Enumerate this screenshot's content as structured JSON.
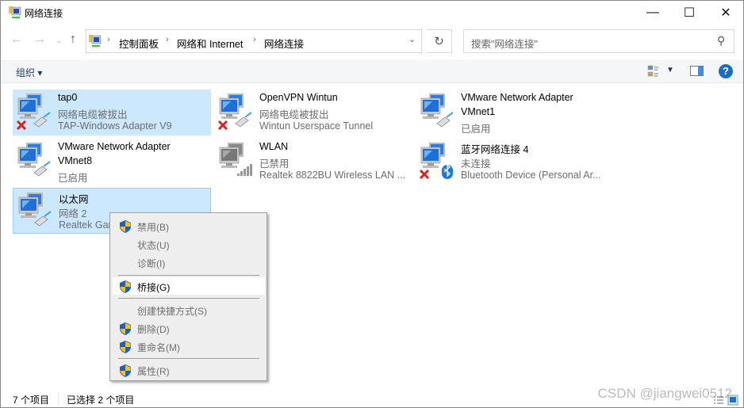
{
  "window": {
    "title": "网络连接",
    "minimize": "—",
    "maximize": "☐",
    "close": "✕"
  },
  "address": {
    "crumbs": [
      "控制面板",
      "网络和 Internet",
      "网络连接"
    ],
    "refresh": "↻"
  },
  "search": {
    "placeholder": "搜索\"网络连接\""
  },
  "toolbar": {
    "organize": "组织 ▾",
    "help": "?"
  },
  "items": [
    {
      "name": "tap0",
      "status": "网络电缆被拔出",
      "device": "TAP-Windows Adapter V9",
      "state": "disconnected",
      "selected": true
    },
    {
      "name": "OpenVPN Wintun",
      "status": "网络电缆被拔出",
      "device": "Wintun Userspace Tunnel",
      "state": "disconnected",
      "selected": false
    },
    {
      "name": "VMware Network Adapter",
      "status": "VMnet1",
      "device": "已启用",
      "state": "ok",
      "selected": false
    },
    {
      "name": "VMware Network Adapter",
      "status": "VMnet8",
      "device": "已启用",
      "state": "ok",
      "selected": false
    },
    {
      "name": "WLAN",
      "status": "已禁用",
      "device": "Realtek 8822BU Wireless LAN ...",
      "state": "wifi-disabled",
      "selected": false
    },
    {
      "name": "蓝牙网络连接 4",
      "status": "未连接",
      "device": "Bluetooth Device (Personal Ar...",
      "state": "bluetooth",
      "selected": false
    },
    {
      "name": "以太网",
      "status": "网络 2",
      "device": "Realtek Gaming GbE Family Controller",
      "state": "ok",
      "selected": true
    }
  ],
  "context_menu": [
    {
      "label": "禁用(B)",
      "shield": true
    },
    {
      "label": "状态(U)",
      "shield": false
    },
    {
      "label": "诊断(I)",
      "shield": false
    },
    {
      "label": "桥接(G)",
      "shield": true,
      "highlighted": true
    },
    {
      "label": "创建快捷方式(S)",
      "shield": false
    },
    {
      "label": "删除(D)",
      "shield": true
    },
    {
      "label": "重命名(M)",
      "shield": true
    },
    {
      "label": "属性(R)",
      "shield": true
    }
  ],
  "statusbar": {
    "count": "7 个项目",
    "selected": "已选择 2 个项目"
  },
  "watermark": "CSDN @jiangwei0512",
  "colors": {
    "selection": "#cce8ff",
    "help": "#1a6dc5"
  }
}
